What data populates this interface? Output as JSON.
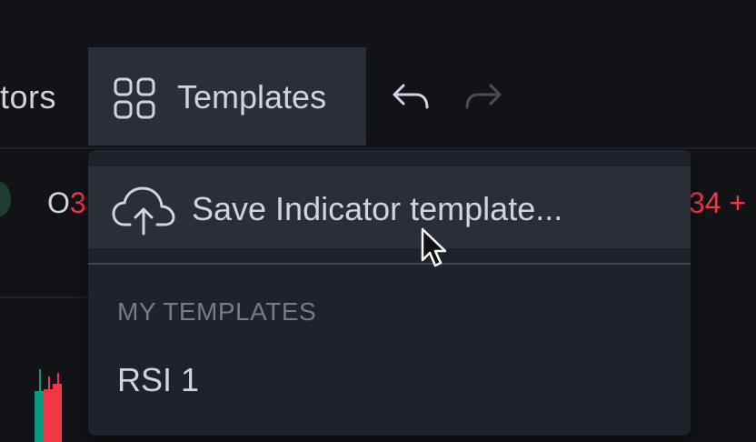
{
  "toolbar": {
    "indicators_label": "tors",
    "templates_label": "Templates",
    "icons": [
      "grid-icon",
      "undo-icon",
      "redo-icon"
    ]
  },
  "legend": {
    "ohlc_left_prefix": "O",
    "ohlc_left_value": "3",
    "ohlc_right_value": "34 +"
  },
  "dropdown": {
    "save_label": "Save Indicator template...",
    "save_icon": "cloud-upload-icon",
    "section_title": "MY TEMPLATES",
    "items": [
      {
        "label": "RSI 1"
      }
    ]
  },
  "colors": {
    "background": "#121317",
    "toolbar_active": "#2a2e39",
    "dropdown_bg": "#1e222d",
    "text": "#d1d4dc",
    "muted_text": "#787b86",
    "negative": "#f23645",
    "positive": "#089981"
  }
}
